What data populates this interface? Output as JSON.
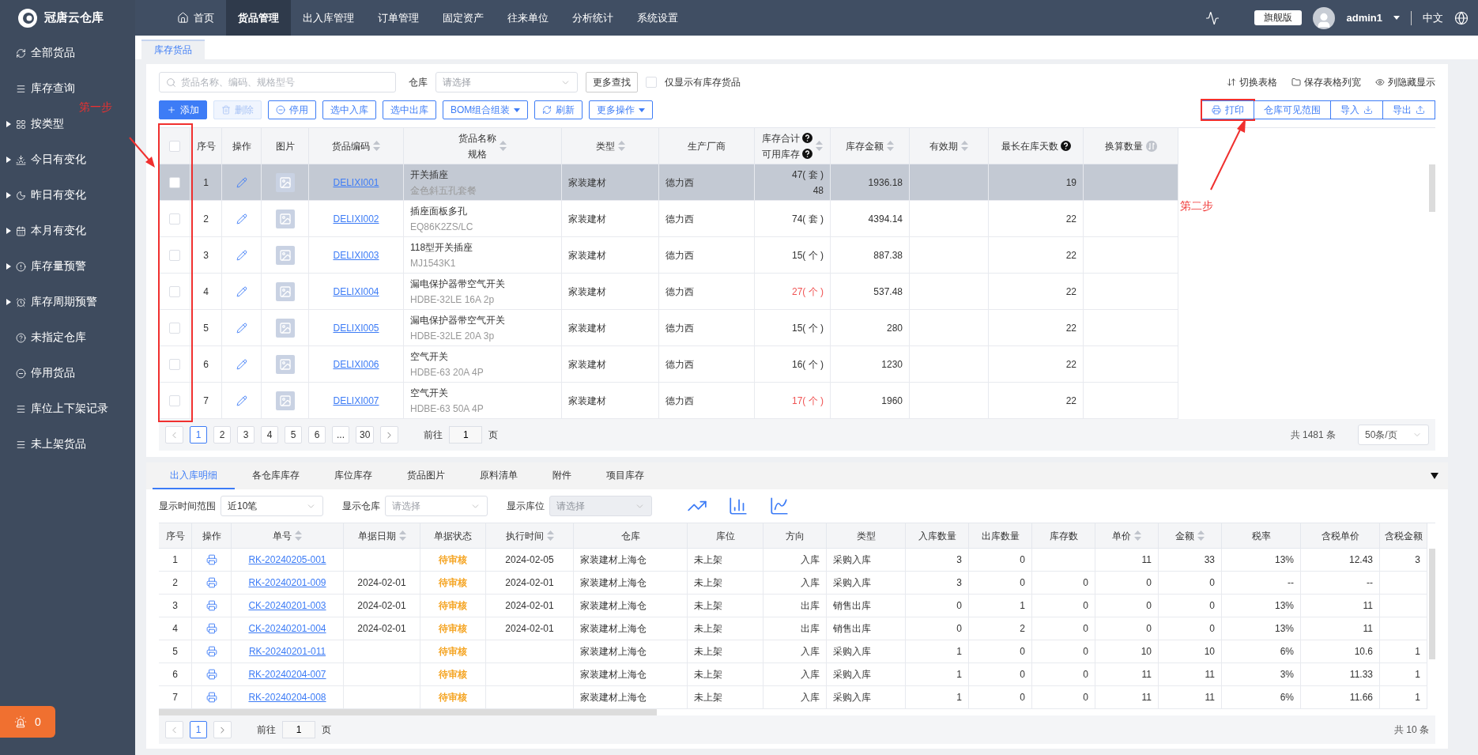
{
  "app": {
    "name": "冠唐云仓库"
  },
  "nav": [
    {
      "label": "首页",
      "selected": false
    },
    {
      "label": "货品管理",
      "selected": true
    },
    {
      "label": "出入库管理",
      "selected": false
    },
    {
      "label": "订单管理",
      "selected": false
    },
    {
      "label": "固定资产",
      "selected": false
    },
    {
      "label": "往来单位",
      "selected": false
    },
    {
      "label": "分析统计",
      "selected": false
    },
    {
      "label": "系统设置",
      "selected": false
    }
  ],
  "user": {
    "edition": "旗舰版",
    "name": "admin1",
    "language": "中文"
  },
  "sidebar": {
    "items": [
      {
        "label": "全部货品",
        "expandable": false
      },
      {
        "label": "库存查询",
        "expandable": false
      },
      {
        "label": "按类型",
        "expandable": true
      },
      {
        "label": "今日有变化",
        "expandable": true
      },
      {
        "label": "昨日有变化",
        "expandable": true
      },
      {
        "label": "本月有变化",
        "expandable": true
      },
      {
        "label": "库存量预警",
        "expandable": true
      },
      {
        "label": "库存周期预警",
        "expandable": true
      },
      {
        "label": "未指定仓库",
        "expandable": false
      },
      {
        "label": "停用货品",
        "expandable": false
      },
      {
        "label": "库位上下架记录",
        "expandable": false
      },
      {
        "label": "未上架货品",
        "expandable": false
      }
    ],
    "alarm_count": "0"
  },
  "page_tabs": [
    {
      "label": "库存货品",
      "selected": true
    }
  ],
  "filters": {
    "search_placeholder": "货品名称、编码、规格型号",
    "warehouse_label": "仓库",
    "warehouse_placeholder": "请选择",
    "more_button": "更多查找",
    "stock_only": {
      "label": "仅显示有库存货品",
      "checked": false
    }
  },
  "actions": [
    {
      "label": "添加",
      "kind": "primary",
      "disabled": false,
      "dropdown": false
    },
    {
      "label": "删除",
      "kind": "plain",
      "disabled": true,
      "dropdown": false
    },
    {
      "label": "停用",
      "kind": "plain",
      "disabled": false,
      "dropdown": false
    },
    {
      "label": "选中入库",
      "kind": "plain",
      "disabled": false,
      "dropdown": false
    },
    {
      "label": "选中出库",
      "kind": "plain",
      "disabled": false,
      "dropdown": false
    },
    {
      "label": "BOM组合组装",
      "kind": "plain",
      "disabled": false,
      "dropdown": true
    },
    {
      "label": "刷新",
      "kind": "plain",
      "disabled": false,
      "dropdown": false
    },
    {
      "label": "更多操作",
      "kind": "plain",
      "disabled": false,
      "dropdown": true
    }
  ],
  "table_links": [
    "切换表格",
    "保存表格列宽",
    "列隐藏显示"
  ],
  "table_buttons": [
    "打印",
    "仓库可见范围",
    "导入",
    "导出"
  ],
  "goods_table": {
    "select_all": {
      "checked": false
    },
    "columns": [
      {
        "label": "序号",
        "sortable": false,
        "help": false
      },
      {
        "label": "操作",
        "sortable": false,
        "help": false
      },
      {
        "label": "图片",
        "sortable": false,
        "help": false
      },
      {
        "label": "货品编码",
        "sortable": true,
        "help": false
      },
      {
        "label": "货品名称",
        "sub_label": "规格",
        "sortable": true,
        "help": false
      },
      {
        "label": "类型",
        "sortable": true,
        "help": false
      },
      {
        "label": "生产厂商",
        "sortable": false,
        "help": false
      },
      {
        "label": "库存合计",
        "sub_label": "可用库存",
        "sortable": true,
        "help": true
      },
      {
        "label": "库存金额",
        "sortable": true,
        "help": false
      },
      {
        "label": "有效期",
        "sortable": true,
        "help": false
      },
      {
        "label": "最长在库天数",
        "sortable": false,
        "help": true
      },
      {
        "label": "换算数量",
        "sortable": false,
        "help": false,
        "toggle": true
      }
    ],
    "rows": [
      {
        "no": "1",
        "checked": false,
        "selected": true,
        "code": "DELIXI001",
        "name": "开关插座",
        "spec": "金色斜五孔套餐",
        "type": "家装建材",
        "maker": "德力西",
        "stock": "47( 套 )",
        "available": "48",
        "low_stock": false,
        "amount": "1936.18",
        "days": "19"
      },
      {
        "no": "2",
        "checked": false,
        "selected": false,
        "code": "DELIXI002",
        "name": "插座面板多孔",
        "spec": "EQ86K2ZS/LC",
        "type": "家装建材",
        "maker": "德力西",
        "stock": "74( 套 )",
        "low_stock": false,
        "amount": "4394.14",
        "days": "22"
      },
      {
        "no": "3",
        "checked": false,
        "selected": false,
        "code": "DELIXI003",
        "name": "118型开关插座",
        "spec": "MJ1543K1",
        "type": "家装建材",
        "maker": "德力西",
        "stock": "15( 个 )",
        "low_stock": false,
        "amount": "887.38",
        "days": "22"
      },
      {
        "no": "4",
        "checked": false,
        "selected": false,
        "code": "DELIXI004",
        "name": "漏电保护器带空气开关",
        "spec": "HDBE-32LE 16A 2p",
        "type": "家装建材",
        "maker": "德力西",
        "stock": "27( 个 )",
        "low_stock": true,
        "amount": "537.48",
        "days": "22"
      },
      {
        "no": "5",
        "checked": false,
        "selected": false,
        "code": "DELIXI005",
        "name": "漏电保护器带空气开关",
        "spec": "HDBE-32LE 20A 3p",
        "type": "家装建材",
        "maker": "德力西",
        "stock": "15( 个 )",
        "low_stock": false,
        "amount": "280",
        "days": "22"
      },
      {
        "no": "6",
        "checked": false,
        "selected": false,
        "code": "DELIXI006",
        "name": "空气开关",
        "spec": "HDBE-63 20A 4P",
        "type": "家装建材",
        "maker": "德力西",
        "stock": "16( 个 )",
        "low_stock": false,
        "amount": "1230",
        "days": "22"
      },
      {
        "no": "7",
        "checked": false,
        "selected": false,
        "code": "DELIXI007",
        "name": "空气开关",
        "spec": "HDBE-63 50A 4P",
        "type": "家装建材",
        "maker": "德力西",
        "stock": "17( 个 )",
        "low_stock": true,
        "amount": "1960",
        "days": "22"
      }
    ]
  },
  "goods_pager": {
    "pages": [
      {
        "label": "1",
        "selected": true
      },
      {
        "label": "2",
        "selected": false
      },
      {
        "label": "3",
        "selected": false
      },
      {
        "label": "4",
        "selected": false
      },
      {
        "label": "5",
        "selected": false
      },
      {
        "label": "6",
        "selected": false
      },
      {
        "label": "...",
        "selected": false
      },
      {
        "label": "30",
        "selected": false
      }
    ],
    "goto_label": "前往",
    "goto_value": "1",
    "page_unit": "页",
    "total": "共 1481 条",
    "page_size": "50条/页"
  },
  "detail_tabs": [
    {
      "label": "出入库明细",
      "selected": true
    },
    {
      "label": "各仓库库存",
      "selected": false
    },
    {
      "label": "库位库存",
      "selected": false
    },
    {
      "label": "货品图片",
      "selected": false
    },
    {
      "label": "原料清单",
      "selected": false
    },
    {
      "label": "附件",
      "selected": false
    },
    {
      "label": "项目库存",
      "selected": false
    }
  ],
  "detail_filters": [
    {
      "label": "显示时间范围",
      "value": "近10笔",
      "disabled": false
    },
    {
      "label": "显示仓库",
      "placeholder": "请选择",
      "disabled": false
    },
    {
      "label": "显示库位",
      "placeholder": "请选择",
      "disabled": true
    }
  ],
  "detail_table": {
    "columns": [
      {
        "label": "序号",
        "sortable": false
      },
      {
        "label": "操作",
        "sortable": false
      },
      {
        "label": "单号",
        "sortable": true
      },
      {
        "label": "单据日期",
        "sortable": true
      },
      {
        "label": "单据状态",
        "sortable": false
      },
      {
        "label": "执行时间",
        "sortable": true
      },
      {
        "label": "仓库",
        "sortable": false
      },
      {
        "label": "库位",
        "sortable": false
      },
      {
        "label": "方向",
        "sortable": false
      },
      {
        "label": "类型",
        "sortable": false
      },
      {
        "label": "入库数量",
        "sortable": false
      },
      {
        "label": "出库数量",
        "sortable": false
      },
      {
        "label": "库存数",
        "sortable": false
      },
      {
        "label": "单价",
        "sortable": true
      },
      {
        "label": "金额",
        "sortable": true
      },
      {
        "label": "税率",
        "sortable": false
      },
      {
        "label": "含税单价",
        "sortable": false
      },
      {
        "label": "含税金额",
        "sortable": false
      }
    ],
    "rows": [
      {
        "no": "1",
        "doc": "RK-20240205-001",
        "date": "",
        "status": "待审核",
        "exec": "2024-02-05",
        "warehouse": "家装建材上海仓",
        "bin": "未上架",
        "dir": "入库",
        "type": "采购入库",
        "in": "3",
        "out": "0",
        "stock": "",
        "price": "11",
        "amount": "33",
        "tax": "13%",
        "tax_price": "12.43",
        "tax_amount": "3"
      },
      {
        "no": "2",
        "doc": "RK-20240201-009",
        "date": "2024-02-01",
        "status": "待审核",
        "exec": "2024-02-01",
        "warehouse": "家装建材上海仓",
        "bin": "未上架",
        "dir": "入库",
        "type": "采购入库",
        "in": "3",
        "out": "0",
        "stock": "0",
        "price": "0",
        "amount": "0",
        "tax": "--",
        "tax_price": "--",
        "tax_amount": ""
      },
      {
        "no": "3",
        "doc": "CK-20240201-003",
        "date": "2024-02-01",
        "status": "待审核",
        "exec": "2024-02-01",
        "warehouse": "家装建材上海仓",
        "bin": "未上架",
        "dir": "出库",
        "type": "销售出库",
        "in": "0",
        "out": "1",
        "stock": "0",
        "price": "0",
        "amount": "0",
        "tax": "13%",
        "tax_price": "11",
        "tax_amount": ""
      },
      {
        "no": "4",
        "doc": "CK-20240201-004",
        "date": "2024-02-01",
        "status": "待审核",
        "exec": "2024-02-01",
        "warehouse": "家装建材上海仓",
        "bin": "未上架",
        "dir": "出库",
        "type": "销售出库",
        "in": "0",
        "out": "2",
        "stock": "0",
        "price": "0",
        "amount": "0",
        "tax": "13%",
        "tax_price": "11",
        "tax_amount": ""
      },
      {
        "no": "5",
        "doc": "RK-20240201-011",
        "date": "",
        "status": "待审核",
        "exec": "",
        "warehouse": "家装建材上海仓",
        "bin": "未上架",
        "dir": "入库",
        "type": "采购入库",
        "in": "1",
        "out": "0",
        "stock": "0",
        "price": "10",
        "amount": "10",
        "tax": "6%",
        "tax_price": "10.6",
        "tax_amount": "1"
      },
      {
        "no": "6",
        "doc": "RK-20240204-007",
        "date": "",
        "status": "待审核",
        "exec": "",
        "warehouse": "家装建材上海仓",
        "bin": "未上架",
        "dir": "入库",
        "type": "采购入库",
        "in": "1",
        "out": "0",
        "stock": "0",
        "price": "11",
        "amount": "11",
        "tax": "3%",
        "tax_price": "11.33",
        "tax_amount": "1"
      },
      {
        "no": "7",
        "doc": "RK-20240204-008",
        "date": "",
        "status": "待审核",
        "exec": "",
        "warehouse": "家装建材上海仓",
        "bin": "未上架",
        "dir": "入库",
        "type": "采购入库",
        "in": "1",
        "out": "0",
        "stock": "0",
        "price": "11",
        "amount": "11",
        "tax": "6%",
        "tax_price": "11.66",
        "tax_amount": "1"
      }
    ]
  },
  "detail_pager": {
    "pages": [
      {
        "label": "1",
        "selected": true
      }
    ],
    "goto_label": "前往",
    "goto_value": "1",
    "page_unit": "页",
    "total": "共 10 条"
  },
  "annotations": [
    {
      "kind": "step",
      "label": "第一步"
    },
    {
      "kind": "step",
      "label": "第二步"
    }
  ]
}
